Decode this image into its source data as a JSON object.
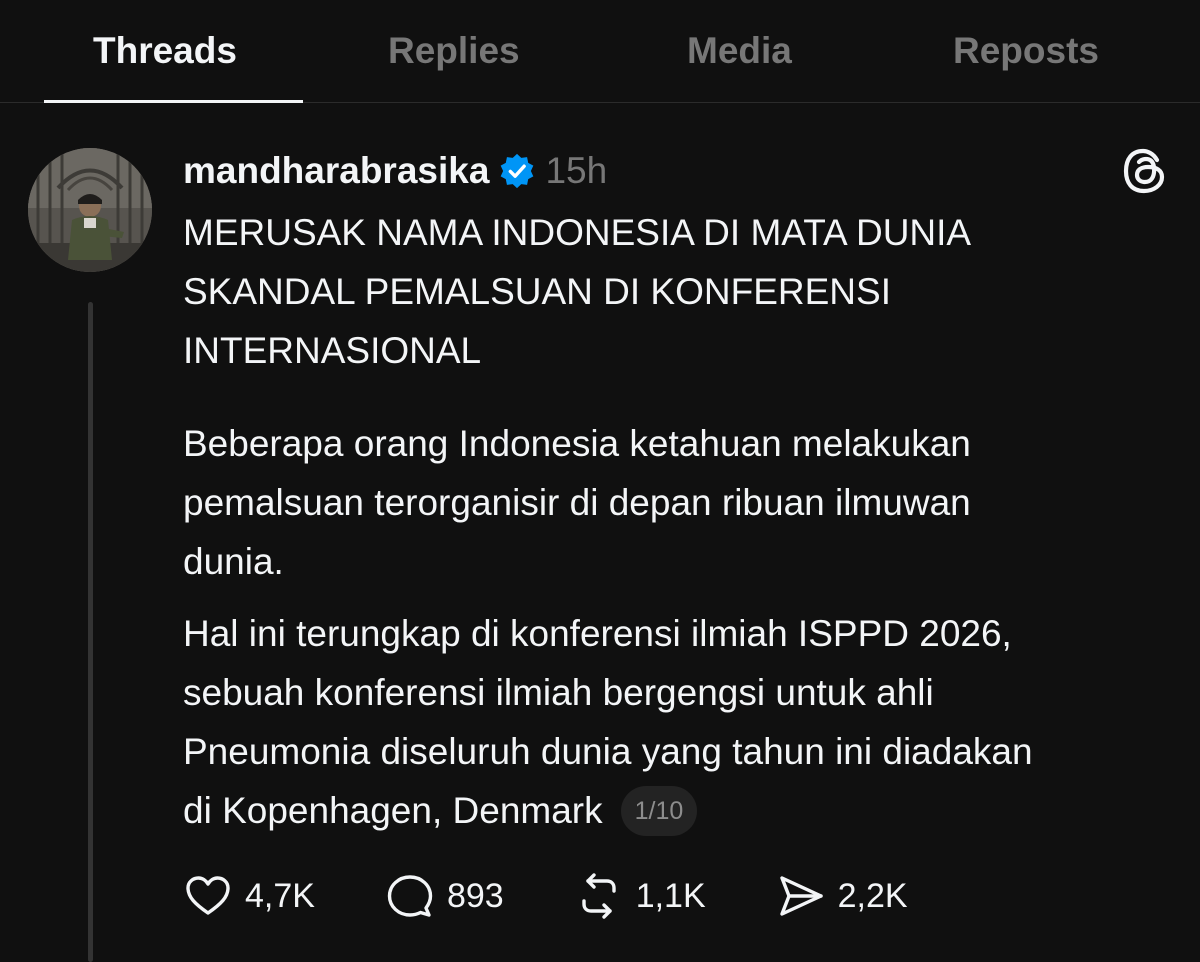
{
  "tabs": [
    {
      "label": "Threads",
      "active": true
    },
    {
      "label": "Replies",
      "active": false
    },
    {
      "label": "Media",
      "active": false
    },
    {
      "label": "Reposts",
      "active": false
    }
  ],
  "post": {
    "username": "mandharabrasika",
    "verified": true,
    "time": "15h",
    "headline_lines": [
      "MERUSAK NAMA INDONESIA DI MATA DUNIA",
      "SKANDAL PEMALSUAN DI KONFERENSI",
      "INTERNASIONAL"
    ],
    "paragraph1_lines": [
      "Beberapa orang Indonesia ketahuan melakukan",
      "pemalsuan terorganisir di depan ribuan ilmuwan",
      "dunia."
    ],
    "paragraph2_lines": [
      "Hal ini terungkap di konferensi ilmiah ISPPD 2026,",
      "sebuah konferensi ilmiah bergengsi untuk ahli",
      "Pneumonia diseluruh dunia yang tahun ini diadakan",
      "di Kopenhagen, Denmark"
    ],
    "thread_counter": "1/10",
    "stats": {
      "likes": "4,7K",
      "replies": "893",
      "reposts": "1,1K",
      "shares": "2,2K"
    }
  },
  "colors": {
    "background": "#101010",
    "text_primary": "#f3f5f7",
    "text_secondary": "#777777",
    "verified_blue": "#0095f6",
    "divider": "#2b2b2b"
  },
  "icons": [
    "verified-badge-icon",
    "threads-logo-icon",
    "heart-icon",
    "comment-icon",
    "repost-icon",
    "share-icon"
  ]
}
